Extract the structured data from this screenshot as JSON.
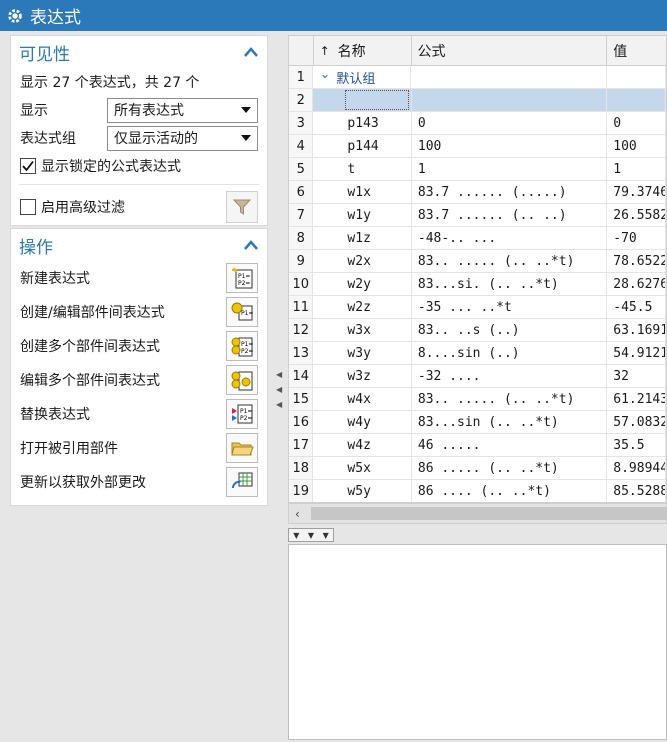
{
  "window": {
    "title": "表达式",
    "icon": "gear-icon"
  },
  "visibility": {
    "title": "可见性",
    "summary": "显示 27 个表达式，共 27 个",
    "show_label": "显示",
    "show_value": "所有表达式",
    "group_label": "表达式组",
    "group_value": "仅显示活动的",
    "locked_label": "显示锁定的公式表达式",
    "locked_checked": true,
    "advanced_label": "启用高级过滤",
    "advanced_checked": false
  },
  "operations": {
    "title": "操作",
    "items": [
      {
        "label": "新建表达式",
        "icon": "new-expression-icon"
      },
      {
        "label": "创建/编辑部件间表达式",
        "icon": "interpart-expression-icon"
      },
      {
        "label": "创建多个部件间表达式",
        "icon": "multi-interpart-create-icon"
      },
      {
        "label": "编辑多个部件间表达式",
        "icon": "multi-interpart-edit-icon"
      },
      {
        "label": "替换表达式",
        "icon": "replace-expression-icon"
      },
      {
        "label": "打开被引用部件",
        "icon": "open-folder-icon"
      },
      {
        "label": "更新以获取外部更改",
        "icon": "update-external-icon"
      }
    ]
  },
  "table": {
    "headers": {
      "name": "名称",
      "formula": "公式",
      "value": "值"
    },
    "rows": [
      {
        "num": "1",
        "name": "默认组",
        "formula": "",
        "value": ""
      },
      {
        "num": "2",
        "name": "",
        "formula": "",
        "value": ""
      },
      {
        "num": "3",
        "name": "p143",
        "formula": "0",
        "value": "0"
      },
      {
        "num": "4",
        "name": "p144",
        "formula": "100",
        "value": "100"
      },
      {
        "num": "5",
        "name": "t",
        "formula": "1",
        "value": "1"
      },
      {
        "num": "6",
        "name": "w1x",
        "formula": "83.7 ...... (.....)",
        "value": "79.3746"
      },
      {
        "num": "7",
        "name": "w1y",
        "formula": "83.7 ...... (.. ..)",
        "value": "26.5582"
      },
      {
        "num": "8",
        "name": "w1z",
        "formula": "-48-.. ...",
        "value": "-70"
      },
      {
        "num": "9",
        "name": "w2x",
        "formula": "83.. ..... (.. ..*t)",
        "value": "78.6522"
      },
      {
        "num": "10",
        "name": "w2y",
        "formula": "83...si. (.. ..*t)",
        "value": "28.6276"
      },
      {
        "num": "11",
        "name": "w2z",
        "formula": "-35 ... ..*t",
        "value": "-45.5"
      },
      {
        "num": "12",
        "name": "w3x",
        "formula": "83.. ..s (..)",
        "value": "63.1691"
      },
      {
        "num": "13",
        "name": "w3y",
        "formula": "8....sin (..)",
        "value": "54.9121"
      },
      {
        "num": "14",
        "name": "w3z",
        "formula": "-32 ....",
        "value": "32"
      },
      {
        "num": "15",
        "name": "w4x",
        "formula": "83.. ..... (.. ..*t)",
        "value": "61.2143"
      },
      {
        "num": "16",
        "name": "w4y",
        "formula": "83...sin (.. ..*t)",
        "value": "57.0832"
      },
      {
        "num": "17",
        "name": "w4z",
        "formula": "46 .....",
        "value": "35.5"
      },
      {
        "num": "18",
        "name": "w5x",
        "formula": "86 ..... (.. ..*t)",
        "value": "8.98944"
      },
      {
        "num": "19",
        "name": "w5y",
        "formula": "86 .... (.. ..*t)",
        "value": "85.5288"
      }
    ]
  },
  "colors": {
    "accent": "#2b79b8",
    "selection": "#c5d7ea"
  }
}
